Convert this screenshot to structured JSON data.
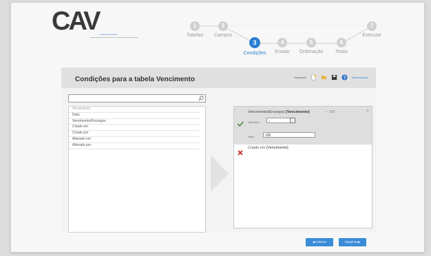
{
  "logo": {
    "text": "CAV",
    "subtitle": "Controle Avançado"
  },
  "wizard": {
    "steps": [
      {
        "num": "1",
        "label": "Tabelas"
      },
      {
        "num": "2",
        "label": "Campos"
      },
      {
        "num": "3",
        "label": "Condições"
      },
      {
        "num": "4",
        "label": "Ensaio"
      },
      {
        "num": "5",
        "label": "Ordenação"
      },
      {
        "num": "6",
        "label": "Totais"
      },
      {
        "num": "7",
        "label": "Executar"
      }
    ]
  },
  "header": {
    "title": "Condições para a tabela Vencimento",
    "toolbar_label": "Avançado",
    "toolbar_link": "Salvar layout"
  },
  "fields": {
    "search_placeholder": "",
    "items": [
      "Vencimento",
      "Data",
      "Vencimento/Encargos",
      "Criado em",
      "Criado por",
      "Alterado em",
      "Alterado por"
    ]
  },
  "condition": {
    "title_prefix": "Vencimento/Encargos",
    "title_table": "[Vencimento]",
    "ops": "— SW",
    "close": "×",
    "operator_label": "Operador",
    "operator_value": "=",
    "value_label": "Valor",
    "value": "100",
    "cond2_prefix": "Criado em",
    "cond2_table": "[Vencimento]"
  },
  "footer": {
    "prev_label": "◀ Anterior",
    "next_label": "Seguinte ▶"
  },
  "colors": {
    "accent": "#3a8bd8",
    "step_active": "#2a7fd0",
    "step_inactive": "#c8c8c8"
  }
}
